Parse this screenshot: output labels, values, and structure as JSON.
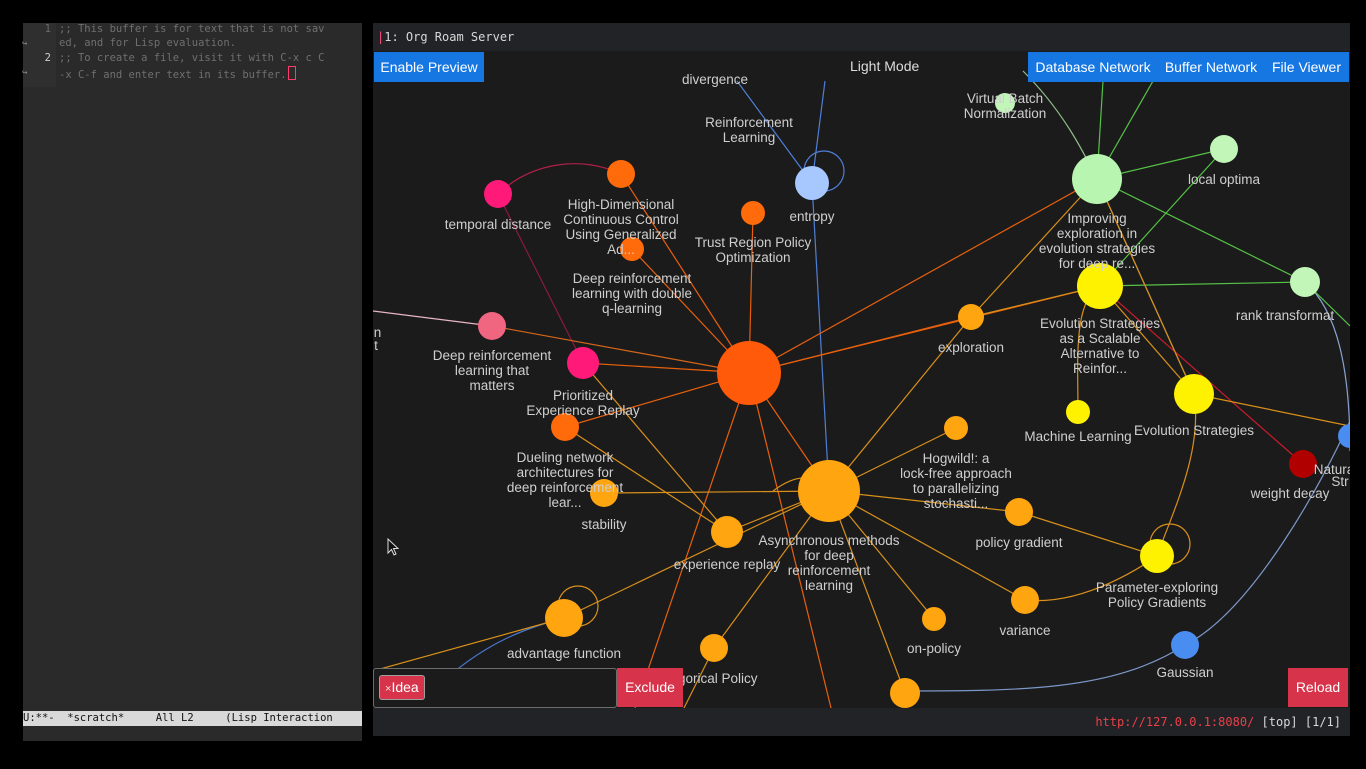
{
  "emacs": {
    "lines": [
      {
        "num": "1",
        "text": ";; This buffer is for text that is not sav",
        "cont": "ed, and for Lisp evaluation."
      },
      {
        "num": "2",
        "text": ";; To create a file, visit it with C-x c C",
        "cont": "-x C-f and enter text in its buffer."
      }
    ],
    "modeline": "U:**-  *scratch*     All L2     (Lisp Interaction"
  },
  "server": {
    "title": "1: Org Roam Server",
    "enable_preview": "Enable Preview",
    "light_mode": "Light Mode",
    "tabs": [
      "Database Network",
      "Buffer Network",
      "File Viewer"
    ],
    "filter_tag": "Idea",
    "filter_tag_remove": "×",
    "exclude": "Exclude",
    "reload": "Reload",
    "status_url": "http://127.0.0.1:8080/",
    "status_pos": "[top] [1/1]"
  },
  "graph": {
    "nodes": [
      {
        "id": "rl",
        "label": [
          "Reinforcement",
          "Learning"
        ],
        "color": "#ff5a0a"
      },
      {
        "id": "async",
        "label": [
          "Asynchronous methods",
          "for deep",
          "reinforcement",
          "learning"
        ],
        "color": "#ffa510"
      },
      {
        "id": "imp",
        "label": [
          "Improving",
          "exploration in",
          "evolution strategies",
          "for deep re..."
        ],
        "color": "#b8f5b0"
      },
      {
        "id": "es_scal",
        "label": [
          "Evolution Strategies",
          "as a Scalable",
          "Alternative to",
          "Reinfor..."
        ],
        "color": "#fff200"
      },
      {
        "id": "es",
        "label": [
          "Evolution Strategies"
        ],
        "color": "#fff200"
      },
      {
        "id": "pepg",
        "label": [
          "Parameter-exploring",
          "Policy Gradients"
        ],
        "color": "#fff200"
      },
      {
        "id": "ml",
        "label": [
          "Machine Learning"
        ],
        "color": "#fff200"
      },
      {
        "id": "entropy",
        "label": [
          "entropy"
        ],
        "color": "#a7c7ff"
      },
      {
        "id": "gaussian",
        "label": [
          "Gaussian"
        ],
        "color": "#4a8df0"
      },
      {
        "id": "local",
        "label": [
          "local optima"
        ],
        "color": "#c2f5b8"
      },
      {
        "id": "rank",
        "label": [
          "rank transformat"
        ],
        "color": "#c2f5b8"
      },
      {
        "id": "vbn",
        "label": [
          "Virtual Batch",
          "Normalization"
        ],
        "color": "#c2f5b8"
      },
      {
        "id": "temporal",
        "label": [
          "temporal distance"
        ],
        "color": "#ff1a7a"
      },
      {
        "id": "per",
        "label": [
          "Prioritized",
          "Experience Replay"
        ],
        "color": "#ff1a7a"
      },
      {
        "id": "drlm",
        "label": [
          "Deep reinforcement",
          "learning that",
          "matters"
        ],
        "color": "#f0657f"
      },
      {
        "id": "gae",
        "label": [
          "High-Dimensional",
          "Continuous Control",
          "Using Generalized",
          "Ad..."
        ],
        "color": "#ff6a0a"
      },
      {
        "id": "trpo",
        "label": [
          "Trust Region Policy",
          "Optimization"
        ],
        "color": "#ff6a0a"
      },
      {
        "id": "ddqn",
        "label": [
          "Deep reinforcement",
          "learning with double",
          "q-learning"
        ],
        "color": "#ff6a0a"
      },
      {
        "id": "dueling",
        "label": [
          "Dueling network",
          "architectures for",
          "deep reinforcement",
          "lear..."
        ],
        "color": "#ff6a0a"
      },
      {
        "id": "exploration",
        "label": [
          "exploration"
        ],
        "color": "#ffa510"
      },
      {
        "id": "hogwild",
        "label": [
          "Hogwild!: a",
          "lock-free approach",
          "to parallelizing",
          "stochasti..."
        ],
        "color": "#ffa510"
      },
      {
        "id": "pg",
        "label": [
          "policy gradient"
        ],
        "color": "#ffa510"
      },
      {
        "id": "variance",
        "label": [
          "variance"
        ],
        "color": "#ffa510"
      },
      {
        "id": "onpolicy",
        "label": [
          "on-policy"
        ],
        "color": "#ffa510"
      },
      {
        "id": "stability",
        "label": [
          "stability"
        ],
        "color": "#ffa510"
      },
      {
        "id": "exprep",
        "label": [
          "experience replay"
        ],
        "color": "#ffa510"
      },
      {
        "id": "adv",
        "label": [
          "advantage function"
        ],
        "color": "#ffa510"
      },
      {
        "id": "catpol",
        "label": [
          "egorical Policy"
        ],
        "color": "#ffa510"
      },
      {
        "id": "bottom",
        "label": [],
        "color": "#ffa510"
      },
      {
        "id": "wdecay",
        "label": [
          "weight decay"
        ],
        "color": "#b00000"
      },
      {
        "id": "nat",
        "label": [
          "Natura",
          "Str"
        ],
        "color": "#4a8df0"
      },
      {
        "id": "divergence",
        "label": [
          "divergence"
        ],
        "color": "#ffa510"
      },
      {
        "id": "leftcut",
        "label": [
          "in",
          "t"
        ],
        "color": "#ffb0c0"
      }
    ]
  }
}
